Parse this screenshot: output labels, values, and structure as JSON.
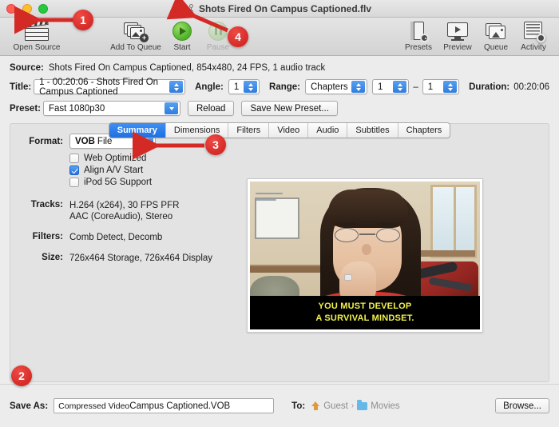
{
  "window": {
    "title": "Shots Fired On Campus Captioned.flv",
    "title_icon": "lock-icon",
    "traffic_lights": [
      "close",
      "minimize",
      "zoom"
    ]
  },
  "toolbar": {
    "left_items": [
      {
        "label": "Open Source",
        "icon": "clapperboard-icon",
        "enabled": true
      },
      {
        "label": "Add To Queue",
        "icon": "add-to-queue-icon",
        "enabled": true
      },
      {
        "label": "Start",
        "icon": "play-icon",
        "enabled": true
      },
      {
        "label": "Pause",
        "icon": "pause-icon",
        "enabled": false
      }
    ],
    "right_items": [
      {
        "label": "Presets",
        "icon": "presets-icon"
      },
      {
        "label": "Preview",
        "icon": "preview-monitor-icon"
      },
      {
        "label": "Queue",
        "icon": "queue-icon"
      },
      {
        "label": "Activity",
        "icon": "activity-icon"
      }
    ]
  },
  "source": {
    "label": "Source:",
    "value": "Shots Fired On Campus Captioned, 854x480, 24 FPS, 1 audio track"
  },
  "title_row": {
    "label": "Title:",
    "value": "1 - 00:20:06 - Shots Fired On Campus Captioned",
    "angle_label": "Angle:",
    "angle_value": "1",
    "range_label": "Range:",
    "range_value": "Chapters",
    "range_start": "1",
    "range_dash": "–",
    "range_end": "1",
    "duration_label": "Duration:",
    "duration_value": "00:20:06"
  },
  "preset_row": {
    "label": "Preset:",
    "value": "Fast 1080p30",
    "reload_label": "Reload",
    "save_preset_label": "Save New Preset..."
  },
  "tabs": [
    {
      "label": "Summary",
      "active": true
    },
    {
      "label": "Dimensions",
      "active": false
    },
    {
      "label": "Filters",
      "active": false
    },
    {
      "label": "Video",
      "active": false
    },
    {
      "label": "Audio",
      "active": false
    },
    {
      "label": "Subtitles",
      "active": false
    },
    {
      "label": "Chapters",
      "active": false
    }
  ],
  "summary": {
    "format_label": "Format:",
    "format_value_bold": "VOB",
    "format_value_rest": "File",
    "checkboxes": [
      {
        "label": "Web Optimized",
        "checked": false
      },
      {
        "label": "Align A/V Start",
        "checked": true
      },
      {
        "label": "iPod 5G Support",
        "checked": false
      }
    ],
    "tracks_label": "Tracks:",
    "tracks_line1": "H.264 (x264), 30 FPS PFR",
    "tracks_line2": "AAC (CoreAudio), Stereo",
    "filters_label": "Filters:",
    "filters_value": "Comb Detect, Decomb",
    "size_label": "Size:",
    "size_value": "726x464 Storage, 726x464 Display"
  },
  "preview": {
    "caption_line1": "YOU MUST DEVELOP",
    "caption_line2": "A SURVIVAL MINDSET.",
    "caption_color": "#f2f24a"
  },
  "bottom": {
    "save_as_label": "Save As:",
    "save_as_value_prefix": "Compressed Video ",
    "save_as_value_name": "Campus Captioned",
    "save_as_value_ext": ".VOB",
    "to_label": "To:",
    "path_home": "Guest",
    "path_sep": "›",
    "path_folder": "Movies",
    "browse_label": "Browse..."
  },
  "annotations": {
    "accent_color": "#d42a26",
    "badges": [
      {
        "number": "1",
        "target": "open-source-button"
      },
      {
        "number": "2",
        "target": "save-as-field"
      },
      {
        "number": "3",
        "target": "format-popup"
      },
      {
        "number": "4",
        "target": "pause-button"
      }
    ]
  }
}
